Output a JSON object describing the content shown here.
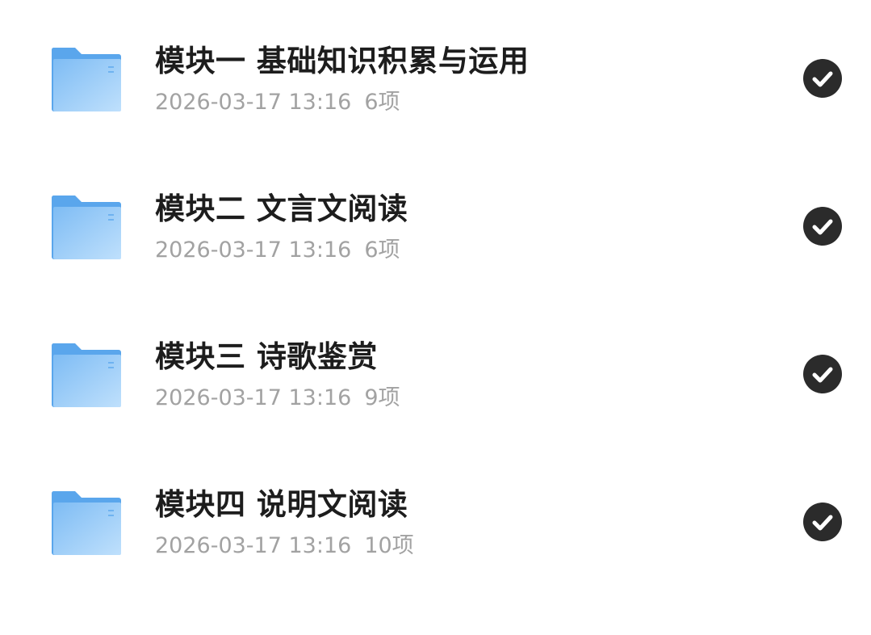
{
  "items": [
    {
      "name": "模块一 基础知识积累与运用",
      "date": "2026-03-17 13:16",
      "count": "6项",
      "selected": true
    },
    {
      "name": "模块二 文言文阅读",
      "date": "2026-03-17 13:16",
      "count": "6项",
      "selected": true
    },
    {
      "name": "模块三 诗歌鉴赏",
      "date": "2026-03-17 13:16",
      "count": "9项",
      "selected": true
    },
    {
      "name": "模块四 说明文阅读",
      "date": "2026-03-17 13:16",
      "count": "10项",
      "selected": true
    }
  ],
  "icons": {
    "folder": "folder-icon",
    "check": "checkmark-icon"
  },
  "colors": {
    "folder_back": "#5aa6ec",
    "folder_front_start": "#7ebcf4",
    "folder_front_end": "#b7dcfb",
    "title_text": "#1d1d1d",
    "meta_text": "#a2a2a2",
    "check_bg": "#2b2b2b"
  }
}
